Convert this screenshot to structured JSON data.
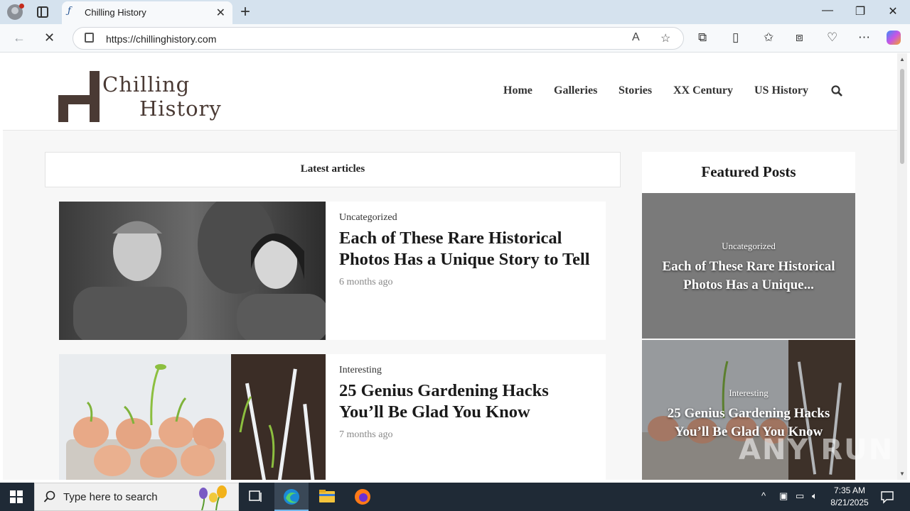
{
  "browser": {
    "tab_title": "Chilling History",
    "url": "https://chillinghistory.com"
  },
  "site": {
    "logo_line1": "Chilling",
    "logo_line2": "History",
    "nav": [
      "Home",
      "Galleries",
      "Stories",
      "XX Century",
      "US History"
    ]
  },
  "main": {
    "section_title": "Latest articles",
    "articles": [
      {
        "category": "Uncategorized",
        "title": "Each of These Rare Historical Photos Has a Unique Story to Tell",
        "date": "6 months ago"
      },
      {
        "category": "Interesting",
        "title": "25 Genius Gardening Hacks You’ll Be Glad You Know",
        "date": "7 months ago"
      }
    ]
  },
  "sidebar": {
    "title": "Featured Posts",
    "posts": [
      {
        "category": "Uncategorized",
        "title": "Each of These Rare Historical Photos Has a Unique..."
      },
      {
        "category": "Interesting",
        "title": "25 Genius Gardening Hacks You’ll Be Glad You Know"
      }
    ]
  },
  "watermark": "ANY RUN",
  "taskbar": {
    "search_placeholder": "Type here to search",
    "time": "7:35 AM",
    "date": "8/21/2025"
  },
  "colors": {
    "logo_brown": "#4a3a34",
    "page_bg": "#f7f7f7",
    "taskbar_bg": "#1f2a36"
  }
}
